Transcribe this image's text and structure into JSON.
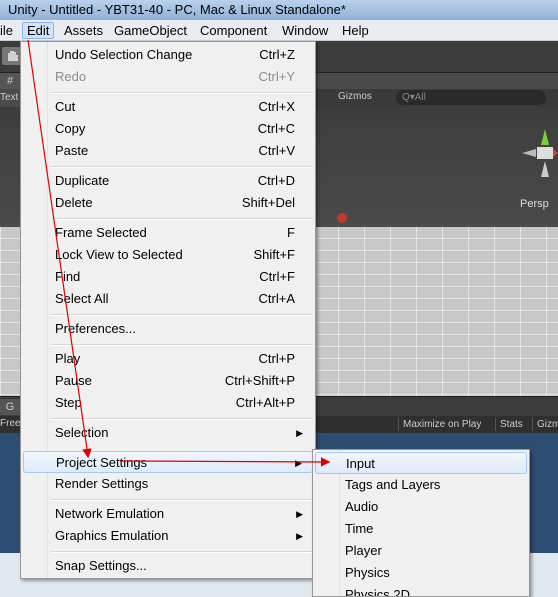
{
  "window": {
    "title": "Unity - Untitled - YBT31-40 - PC, Mac & Linux Standalone*"
  },
  "menubar": {
    "items": [
      "ile",
      "Edit",
      "Assets",
      "GameObject",
      "Component",
      "Window",
      "Help"
    ]
  },
  "scene": {
    "text_label": "Text",
    "gizmos_label": "Gizmos",
    "search_placeholder": "Q▾All",
    "persp_label": "Persp",
    "tab_icon_glyph": "#"
  },
  "game": {
    "tab_icon_glyph": "G",
    "free_label": "Free",
    "maximize_on_play": "Maximize on Play",
    "stats": "Stats",
    "gizmos": "Gizm"
  },
  "edit_menu": {
    "undo": {
      "label": "Undo Selection Change",
      "shortcut": "Ctrl+Z"
    },
    "redo": {
      "label": "Redo",
      "shortcut": "Ctrl+Y"
    },
    "cut": {
      "label": "Cut",
      "shortcut": "Ctrl+X"
    },
    "copy": {
      "label": "Copy",
      "shortcut": "Ctrl+C"
    },
    "paste": {
      "label": "Paste",
      "shortcut": "Ctrl+V"
    },
    "duplicate": {
      "label": "Duplicate",
      "shortcut": "Ctrl+D"
    },
    "delete": {
      "label": "Delete",
      "shortcut": "Shift+Del"
    },
    "frame_selected": {
      "label": "Frame Selected",
      "shortcut": "F"
    },
    "lock_view": {
      "label": "Lock View to Selected",
      "shortcut": "Shift+F"
    },
    "find": {
      "label": "Find",
      "shortcut": "Ctrl+F"
    },
    "select_all": {
      "label": "Select All",
      "shortcut": "Ctrl+A"
    },
    "preferences": {
      "label": "Preferences..."
    },
    "play": {
      "label": "Play",
      "shortcut": "Ctrl+P"
    },
    "pause": {
      "label": "Pause",
      "shortcut": "Ctrl+Shift+P"
    },
    "step": {
      "label": "Step",
      "shortcut": "Ctrl+Alt+P"
    },
    "selection": {
      "label": "Selection"
    },
    "project_settings": {
      "label": "Project Settings"
    },
    "render_settings": {
      "label": "Render Settings"
    },
    "network_emulation": {
      "label": "Network Emulation"
    },
    "graphics_emulation": {
      "label": "Graphics Emulation"
    },
    "snap_settings": {
      "label": "Snap Settings..."
    },
    "submenu_arrow": "▶"
  },
  "project_settings_submenu": {
    "items": [
      "Input",
      "Tags and Layers",
      "Audio",
      "Time",
      "Player",
      "Physics",
      "Physics 2D"
    ]
  },
  "colors": {
    "annotation_arrow": "#e00000",
    "menu_hover_border": "#a8c8ef",
    "game_view_bg": "#2e4d73"
  }
}
